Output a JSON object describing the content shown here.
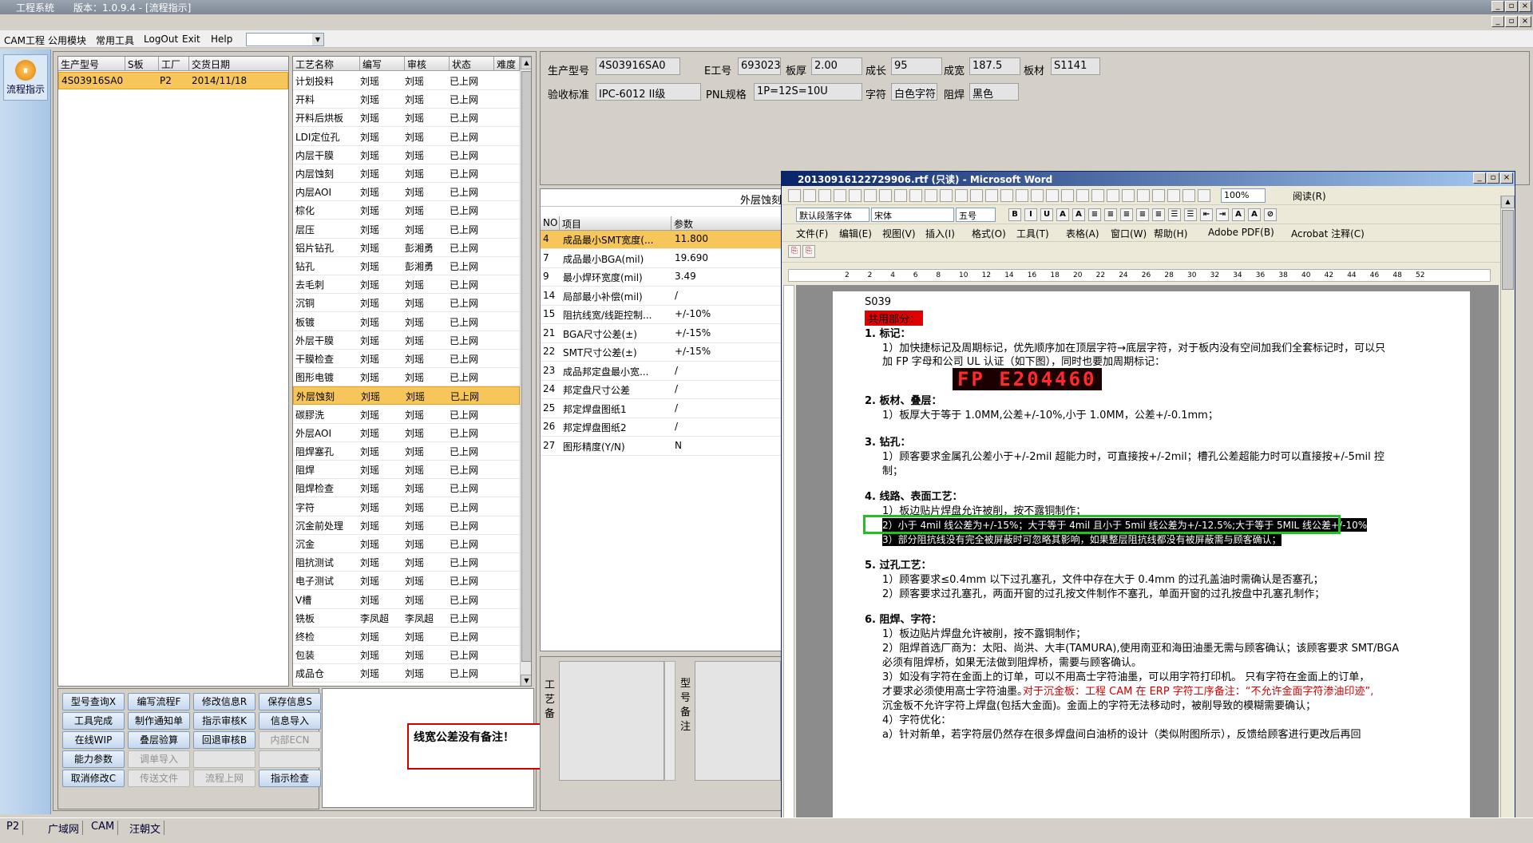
{
  "app": {
    "title": "工程系统",
    "version": "版本：1.0.9.4 - [流程指示]"
  },
  "menu": [
    "CAM工程",
    "公用模块",
    "常用工具",
    "LogOut",
    "Exit",
    "Help"
  ],
  "left": {
    "flow_label": "流程指示"
  },
  "orders": {
    "headers": [
      "生产型号",
      "S板",
      "工厂",
      "交货日期"
    ],
    "rows": [
      [
        "4S03916SA0",
        "",
        "P2",
        "2014/11/18"
      ]
    ]
  },
  "steps": {
    "headers": [
      "工艺名称",
      "编写",
      "审核",
      "状态",
      "难度"
    ],
    "rows": [
      [
        "计划投料",
        "刘瑶",
        "刘瑶",
        "已上网"
      ],
      [
        "开料",
        "刘瑶",
        "刘瑶",
        "已上网"
      ],
      [
        "开料后烘板",
        "刘瑶",
        "刘瑶",
        "已上网"
      ],
      [
        "LDI定位孔",
        "刘瑶",
        "刘瑶",
        "已上网"
      ],
      [
        "内层干膜",
        "刘瑶",
        "刘瑶",
        "已上网"
      ],
      [
        "内层蚀刻",
        "刘瑶",
        "刘瑶",
        "已上网"
      ],
      [
        "内层AOI",
        "刘瑶",
        "刘瑶",
        "已上网"
      ],
      [
        "棕化",
        "刘瑶",
        "刘瑶",
        "已上网"
      ],
      [
        "层压",
        "刘瑶",
        "刘瑶",
        "已上网"
      ],
      [
        "铝片钻孔",
        "刘瑶",
        "彭湘勇",
        "已上网"
      ],
      [
        "钻孔",
        "刘瑶",
        "彭湘勇",
        "已上网"
      ],
      [
        "去毛刺",
        "刘瑶",
        "刘瑶",
        "已上网"
      ],
      [
        "沉铜",
        "刘瑶",
        "刘瑶",
        "已上网"
      ],
      [
        "板镀",
        "刘瑶",
        "刘瑶",
        "已上网"
      ],
      [
        "外层干膜",
        "刘瑶",
        "刘瑶",
        "已上网"
      ],
      [
        "干膜检查",
        "刘瑶",
        "刘瑶",
        "已上网"
      ],
      [
        "图形电镀",
        "刘瑶",
        "刘瑶",
        "已上网"
      ],
      [
        "外层蚀刻",
        "刘瑶",
        "刘瑶",
        "已上网"
      ],
      [
        "碳膠洗",
        "刘瑶",
        "刘瑶",
        "已上网"
      ],
      [
        "外层AOI",
        "刘瑶",
        "刘瑶",
        "已上网"
      ],
      [
        "阻焊塞孔",
        "刘瑶",
        "刘瑶",
        "已上网"
      ],
      [
        "阻焊",
        "刘瑶",
        "刘瑶",
        "已上网"
      ],
      [
        "阻焊检查",
        "刘瑶",
        "刘瑶",
        "已上网"
      ],
      [
        "字符",
        "刘瑶",
        "刘瑶",
        "已上网"
      ],
      [
        "沉金前处理",
        "刘瑶",
        "刘瑶",
        "已上网"
      ],
      [
        "沉金",
        "刘瑶",
        "刘瑶",
        "已上网"
      ],
      [
        "阻抗测试",
        "刘瑶",
        "刘瑶",
        "已上网"
      ],
      [
        "电子测试",
        "刘瑶",
        "刘瑶",
        "已上网"
      ],
      [
        "V槽",
        "刘瑶",
        "刘瑶",
        "已上网"
      ],
      [
        "铣板",
        "李凤超",
        "李凤超",
        "已上网"
      ],
      [
        "终检",
        "刘瑶",
        "刘瑶",
        "已上网"
      ],
      [
        "包装",
        "刘瑶",
        "刘瑶",
        "已上网"
      ],
      [
        "成品仓",
        "刘瑶",
        "刘瑶",
        "已上网"
      ]
    ],
    "selected": 17
  },
  "info": {
    "prod_label": "生产型号",
    "prod": "4S03916SA0",
    "e_label": "E工号",
    "e": "693023",
    "thick_label": "板厚",
    "thick": "2.00",
    "len_label": "成长",
    "len": "95",
    "wid_label": "成宽",
    "wid": "187.5",
    "mat_label": "板材",
    "mat": "S1141",
    "std_label": "验收标准",
    "std": "IPC-6012 II级",
    "pnl_label": "PNL规格",
    "pnl": "1P=12S=10U",
    "char_label": "字符",
    "char": "白色字符",
    "mask_label": "阻焊",
    "mask": "黑色"
  },
  "params": {
    "title": "外层蚀刻",
    "headers": [
      "NO",
      "项目",
      "参数"
    ],
    "rows": [
      [
        "4",
        "成品最小SMT宽度(...",
        "11.800"
      ],
      [
        "7",
        "成品最小BGA(mil)",
        "19.690"
      ],
      [
        "9",
        "最小焊环宽度(mil)",
        "3.49"
      ],
      [
        "14",
        "局部最小补偿(mil)",
        "/"
      ],
      [
        "15",
        "阻抗线宽/线距控制...",
        "+/-10%"
      ],
      [
        "21",
        "BGA尺寸公差(±)",
        "+/-15%"
      ],
      [
        "22",
        "SMT尺寸公差(±)",
        "+/-15%"
      ],
      [
        "23",
        "成品邦定盘最小宽...",
        "/"
      ],
      [
        "24",
        "邦定盘尺寸公差",
        "/"
      ],
      [
        "25",
        "邦定焊盘图纸1",
        "/"
      ],
      [
        "26",
        "邦定焊盘图纸2",
        "/"
      ],
      [
        "27",
        "图形精度(Y/N)",
        "N"
      ]
    ]
  },
  "buttons": [
    [
      "型号查询X",
      "编写流程F",
      "修改信息R",
      "保存信息S"
    ],
    [
      "工具完成",
      "制作通知单",
      "指示审核K",
      "信息导入"
    ],
    [
      "在线WIP",
      "叠层验算",
      "回退审核B",
      "内部ECN"
    ],
    [
      "能力参数",
      "调单导入",
      "",
      ""
    ],
    [
      "取消修改C",
      "传送文件",
      "流程上网",
      "指示检查"
    ]
  ],
  "note": "线宽公差没有备注！",
  "side_labels": {
    "a": "工艺备",
    "b": "型号备注"
  },
  "status_tabs": [
    "P2",
    "广域网",
    "CAM",
    "汪朝文"
  ],
  "word": {
    "title": "20130916122729906.rtf (只读) - Microsoft Word",
    "style": "默认段落字体",
    "font": "宋体",
    "size": "五号",
    "zoom": "100%",
    "read": "阅读(R)",
    "menu": [
      "文件(F)",
      "编辑(E)",
      "视图(V)",
      "插入(I)",
      "格式(O)",
      "工具(T)",
      "表格(A)",
      "窗口(W)",
      "帮助(H)",
      "Adobe PDF(B)",
      "Acrobat 注释(C)"
    ],
    "ruler": [
      "2",
      "2",
      "4",
      "6",
      "8",
      "10",
      "12",
      "14",
      "16",
      "18",
      "20",
      "22",
      "24",
      "26",
      "28",
      "30",
      "32",
      "34",
      "36",
      "38",
      "40",
      "42",
      "44",
      "46",
      "48",
      "52"
    ],
    "lines": [
      "S039",
      "共用部分：",
      "1.  标记：",
      "1）加快捷标记及周期标记，优先顺序加在顶层字符→底层字符，对于板内没有空间加我们全套标记时，可以只",
      "加 FP 字母和公司 UL 认证（如下图），同时也要加周期标记：",
      "FP E204460",
      "2.  板材、叠层：",
      "1）板厚大于等于 1.0MM,公差+/-10%,小于 1.0MM，公差+/-0.1mm；",
      "3.  钻孔：",
      "1）顾客要求金属孔公差小于+/-2mil 超能力时，可直接按+/-2mil；槽孔公差超能力时可以直接按+/-5mil 控",
      "制；",
      "4.  线路、表面工艺：",
      "1）板边贴片焊盘允许被削，按不露铜制作；",
      "2）小于 4mil 线公差为+/-15%；大于等于 4mil 且小于 5mil 线公差为+/-12.5%;大于等于 5MIL 线公差+/-10%",
      "3）部分阻抗线没有完全被屏蔽时可忽略其影响，如果整层阻抗线都没有被屏蔽需与顾客确认；",
      "5.  过孔工艺：",
      "1）顾客要求≤0.4mm 以下过孔塞孔，文件中存在大于 0.4mm 的过孔盖油时需确认是否塞孔；",
      "2）顾客要求过孔塞孔，两面开窗的过孔按文件制作不塞孔，单面开窗的过孔按盘中孔塞孔制作；",
      "6.  阻焊、字符：",
      "1）板边贴片焊盘允许被削，按不露铜制作；",
      "2）阻焊首选厂商为：太阳、尚洪、大丰(TAMURA),使用南亚和海田油墨无需与顾客确认；该顾客要求 SMT/BGA",
      "必须有阻焊桥，如果无法做到阻焊桥，需要与顾客确认。",
      "3）如没有字符在金面上的订单，可以不用高士字符油墨，可以用字符打印机。   只有字符在金面上的订单，",
      "才要求必须使用高士字符油墨。",
      "对于沉金板：工程 CAM 在 ERP 字符工序备注：“不允许金面字符渗油印迹”,",
      "沉金板不允许字符上焊盘(包括大金面)。金面上的字符无法移动时，被削导致的模糊需要确认；",
      "4）字符优化：",
      "a）针对新单，若字符层仍然存在很多焊盘间白油桥的设计（类似附图所示），反馈给顾客进行更改后再回"
    ]
  },
  "colors": {
    "accent": "#f7c65b",
    "green_box": "#22c022",
    "red_box": "#d00000",
    "red_text": "#d00000"
  }
}
